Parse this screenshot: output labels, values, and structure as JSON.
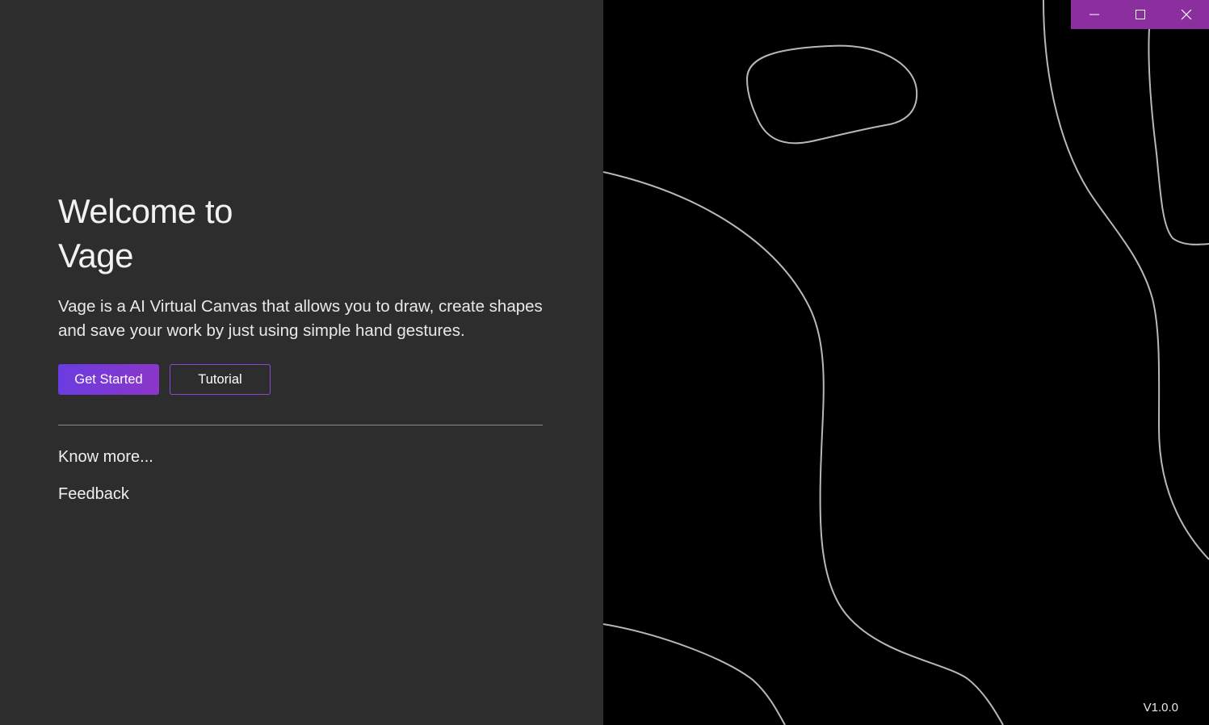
{
  "window": {
    "controls": {
      "minimize_icon": "minimize-icon",
      "maximize_icon": "maximize-icon",
      "close_icon": "close-icon",
      "bar_color": "#8b2f9e"
    }
  },
  "welcome": {
    "title_line1": "Welcome to",
    "title_line2": "Vage",
    "description": "Vage is a AI Virtual Canvas that allows you to draw, create shapes and save your work by just using simple hand gestures."
  },
  "actions": {
    "get_started_label": "Get Started",
    "tutorial_label": "Tutorial"
  },
  "links": {
    "know_more": "Know more...",
    "feedback": "Feedback"
  },
  "footer": {
    "version": "V1.0.0"
  },
  "colors": {
    "left_panel_bg": "#2d2d2d",
    "right_panel_bg": "#000000",
    "accent_start": "#6a3ce0",
    "accent_end": "#8b36c9",
    "line_art": "#b8b8b8"
  }
}
